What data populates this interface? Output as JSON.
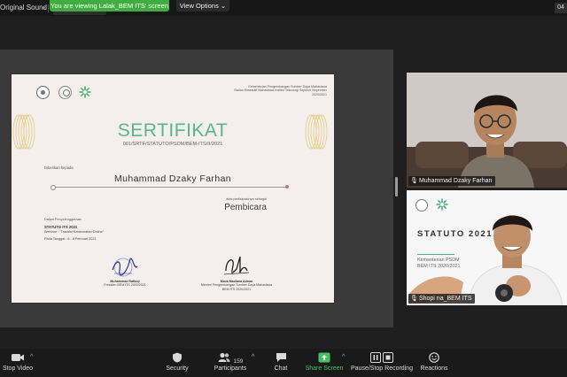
{
  "topbar": {
    "audio_label": "Original Sound",
    "viewing_banner": "You are viewing Lalak_BEM ITS' screen",
    "view_options_label": "View Options",
    "right_chip": "04"
  },
  "certificate": {
    "issuer_line1": "Kementerian Pengembangan Sumber Daya Mahasiswa",
    "issuer_line2": "Badan Eksekutif Mahasiswa Institut Teknologi Sepuluh Nopember",
    "issuer_line3": "2020/2021",
    "title": "SERTIFIKAT",
    "number": "001/SRTF/STATUTO/PSDM/BEM-ITS/II/2021",
    "given_to": "Diberikan kepada",
    "recipient": "Muhammad Dzaky  Farhan",
    "as_participant": "atas partisipasinya sebagai",
    "role": "Pembicara",
    "event_intro": "Dalam Penyelenggaraan",
    "event_name": "STATUTO ITS 2021",
    "event_webinar": "Webinar : \"Transisi Kedaruratan Online\"",
    "event_date": "Pada Tanggal : 6 - 8 Februari 2021",
    "signer_left_name": "Muhammad Rafiuqi",
    "signer_left_role": "Presiden BEM ITS 2020/2021",
    "signer_right_name": "Moza Maulana Adnan",
    "signer_right_role1": "Menteri Pengembangan Sumber Daya Mahasiswa",
    "signer_right_role2": "BEM ITS 2020/2021"
  },
  "participants": [
    {
      "name": "Muhammad Dzaky Farhan"
    },
    {
      "name": "Shopi na_BEM ITS"
    }
  ],
  "slide": {
    "title": "STATUTO 2021",
    "subtitle_line1": "Kementerian PSDM",
    "subtitle_line2": "BEM ITS 2020/2021"
  },
  "controls": {
    "stop_video": "Stop Video",
    "security": "Security",
    "participants": "Participants",
    "participants_count": "159",
    "chat": "Chat",
    "share_screen": "Share Screen",
    "recording": "Pause/Stop Recording",
    "reactions": "Reactions"
  },
  "colors": {
    "share_green": "#45c062",
    "banner_green": "#3fae3f",
    "certificate_accent": "#5ab58a"
  }
}
